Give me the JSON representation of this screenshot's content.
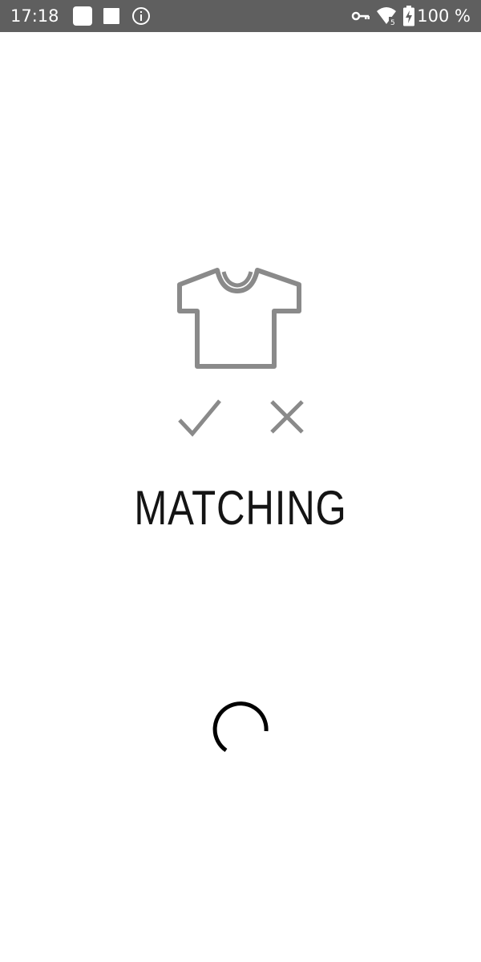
{
  "status_bar": {
    "time": "17:18",
    "battery": "100 %",
    "icons": [
      "app-notification-icon",
      "square-notification-icon",
      "info-icon",
      "vpn-key-icon",
      "wifi-icon",
      "battery-charging-icon"
    ],
    "background_color": "#5f5f5f"
  },
  "main": {
    "illustration_icon": "t-shirt-icon",
    "check_icon": "checkmark-icon",
    "cross_icon": "cross-icon",
    "title": "MATCHING",
    "loading_icon": "loading-spinner-icon",
    "icon_color": "#8a8a8a",
    "title_color": "#141414"
  }
}
